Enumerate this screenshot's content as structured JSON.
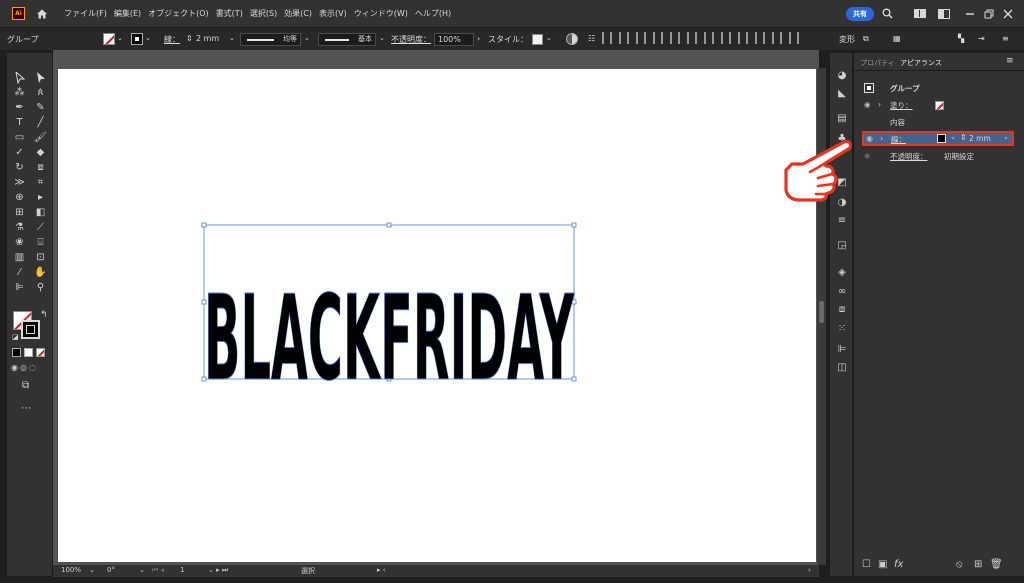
{
  "app": {
    "logo": "Ai",
    "menus": [
      "ファイル(F)",
      "編集(E)",
      "オブジェクト(O)",
      "書式(T)",
      "選択(S)",
      "効果(C)",
      "表示(V)",
      "ウィンドウ(W)",
      "ヘルプ(H)"
    ],
    "share_label": "共有",
    "window_buttons": [
      "search-icon",
      "workspace-icon",
      "arrange-icon",
      "minimize-icon",
      "restore-icon",
      "close-icon"
    ]
  },
  "control_bar": {
    "selection_label": "グループ",
    "stroke_label": "線：",
    "stroke_weight": "2 mm",
    "profile_label": "均等",
    "brush_label": "基本",
    "opacity_label": "不透明度：",
    "opacity_value": "100%",
    "style_label": "スタイル：",
    "transform_label": "変形"
  },
  "artwork": {
    "text": "BLACKFRIDAY",
    "fill_color": "#000000",
    "selection_color": "#4b7bdc"
  },
  "status_bar": {
    "zoom": "100%",
    "rotation": "0°",
    "artboard_number": "1",
    "tool_name": "選択"
  },
  "appearance_panel": {
    "tabs": [
      "プロパティ",
      "アピアランス"
    ],
    "active_tab": "アピアランス",
    "object_type": "グループ",
    "fill_label": "塗り：",
    "contents_label": "内容",
    "stroke_label": "線：",
    "stroke_weight": "2 mm",
    "opacity_label": "不透明度：",
    "opacity_value": "初期設定",
    "highlight_color": "#e8341c"
  }
}
